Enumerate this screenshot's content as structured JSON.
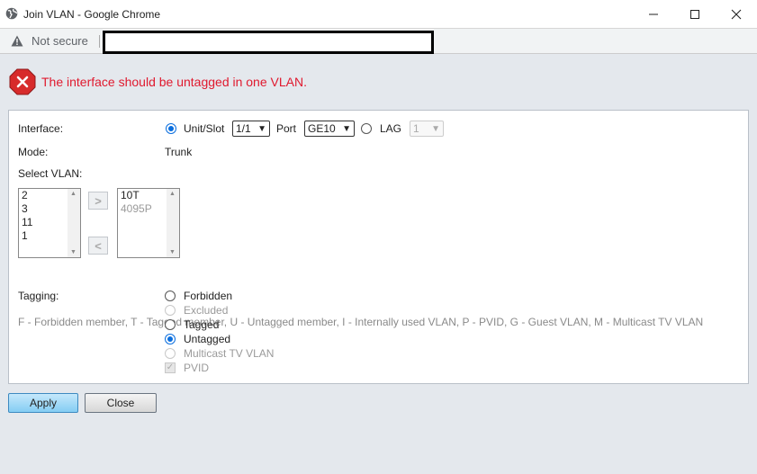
{
  "window": {
    "title": "Join VLAN - Google Chrome",
    "controls": {
      "minimize": "—",
      "maximize": "☐",
      "close": "✕"
    }
  },
  "address_bar": {
    "security_label": "Not secure",
    "url": ""
  },
  "error": {
    "message": "The interface should be untagged in one VLAN."
  },
  "form": {
    "interface_label": "Interface:",
    "unit_slot_label": "Unit/Slot",
    "unit_slot_value": "1/1",
    "port_label": "Port",
    "port_value": "GE10",
    "lag_label": "LAG",
    "lag_value": "1",
    "mode_label": "Mode:",
    "mode_value": "Trunk",
    "select_vlan_label": "Select VLAN:",
    "available_vlans": [
      "2",
      "3",
      "11",
      "1"
    ],
    "selected_vlans": [
      {
        "label": "10T",
        "disabled": false
      },
      {
        "label": "4095P",
        "disabled": true
      }
    ],
    "legend": "F - Forbidden member,   T - Tagged member,   U - Untagged member,   I - Internally used VLAN,   P - PVID,   G - Guest VLAN,   M - Multicast TV VLAN",
    "tagging_label": "Tagging:",
    "tagging_options": {
      "forbidden": "Forbidden",
      "excluded": "Excluded",
      "tagged": "Tagged",
      "untagged": "Untagged",
      "multicast": "Multicast TV VLAN"
    },
    "tagging_selected": "Untagged",
    "pvid_label": "PVID"
  },
  "buttons": {
    "apply": "Apply",
    "close": "Close"
  }
}
